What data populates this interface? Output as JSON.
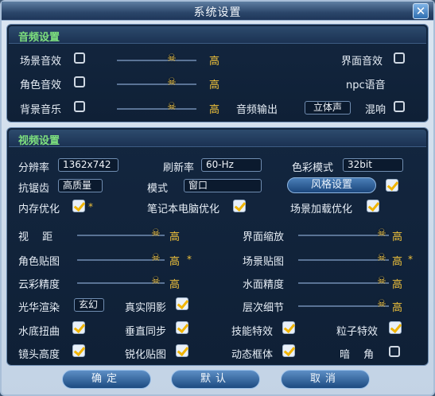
{
  "window": {
    "title": "系统设置",
    "close_glyph": "✕"
  },
  "audio": {
    "header": "音频设置",
    "scene_sound": {
      "label": "场景音效",
      "value": "高"
    },
    "character_sound": {
      "label": "角色音效",
      "value": "高"
    },
    "bg_music": {
      "label": "背景音乐",
      "value": "高"
    },
    "ui_sound": {
      "label": "界面音效"
    },
    "npc_voice": {
      "label": "npc语音"
    },
    "output": {
      "label": "音频输出",
      "value": "立体声"
    },
    "reverb": {
      "label": "混响"
    }
  },
  "video": {
    "header": "视频设置",
    "resolution": {
      "label": "分辨率",
      "value": "1362x742"
    },
    "refresh": {
      "label": "刷新率",
      "value": "60-Hz"
    },
    "color_mode": {
      "label": "色彩模式",
      "value": "32bit"
    },
    "antialias": {
      "label": "抗锯齿",
      "value": "高质量"
    },
    "mode": {
      "label": "模式",
      "value": "窗口"
    },
    "style_button": "风格设置",
    "memory_opt": {
      "label": "内存优化",
      "star": "*"
    },
    "laptop_opt": {
      "label": "笔记本电脑优化"
    },
    "scene_load_opt": {
      "label": "场景加载优化"
    },
    "view_dist": {
      "label": "视　 距",
      "value": "高"
    },
    "ui_scale": {
      "label": "界面缩放",
      "value": "高"
    },
    "char_texture": {
      "label": "角色贴图",
      "value": "高",
      "star": "*"
    },
    "scene_texture": {
      "label": "场景贴图",
      "value": "高",
      "star": "*"
    },
    "cloud_precision": {
      "label": "云彩精度",
      "value": "高"
    },
    "water_precision": {
      "label": "水面精度",
      "value": "高"
    },
    "glow_render": {
      "label": "光华渲染",
      "value": "玄幻"
    },
    "real_shadow": {
      "label": "真实阴影"
    },
    "layer_detail": {
      "label": "层次细节",
      "value": "高"
    },
    "underwater_distort": {
      "label": "水底扭曲"
    },
    "vsync": {
      "label": "垂直同步"
    },
    "skill_effects": {
      "label": "技能特效"
    },
    "particle_effects": {
      "label": "粒子特效"
    },
    "camera_height": {
      "label": "镜头高度"
    },
    "sharpen_texture": {
      "label": "锐化贴图"
    },
    "dynamic_border": {
      "label": "动态框体"
    },
    "vignette": {
      "label": "暗　 角"
    }
  },
  "buttons": {
    "ok": "确定",
    "default": "默认",
    "cancel": "取消"
  },
  "icons": {
    "slider_thumb": "skull-icon",
    "thumb_glyph": "☠"
  }
}
